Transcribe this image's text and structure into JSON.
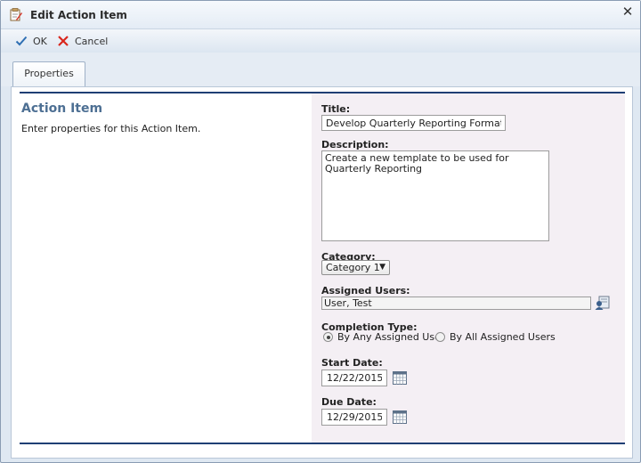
{
  "window": {
    "title": "Edit Action Item"
  },
  "toolbar": {
    "ok_label": "OK",
    "cancel_label": "Cancel"
  },
  "tabs": [
    {
      "label": "Properties",
      "active": true
    }
  ],
  "section": {
    "title": "Action Item",
    "description": "Enter properties for this Action Item."
  },
  "form": {
    "title_label": "Title:",
    "title_value": "Develop Quarterly Reporting Format",
    "description_label": "Description:",
    "description_value": "Create a new template to be used for Quarterly Reporting",
    "category_label": "Category:",
    "category_value": "Category 1",
    "assigned_users_label": "Assigned Users:",
    "assigned_users_value": "User, Test",
    "completion_type_label": "Completion Type:",
    "completion_options": [
      {
        "label": "By Any Assigned User",
        "selected": true
      },
      {
        "label": "By All Assigned Users",
        "selected": false
      }
    ],
    "start_date_label": "Start Date:",
    "start_date_value": "12/22/2015",
    "due_date_label": "Due Date:",
    "due_date_value": "12/29/2015"
  },
  "colors": {
    "accent_rule": "#1f3f74",
    "section_title": "#4d6f93",
    "ok_check": "#2f6fb3",
    "cancel_x": "#d9261c",
    "right_panel_bg": "#f4eff4"
  }
}
